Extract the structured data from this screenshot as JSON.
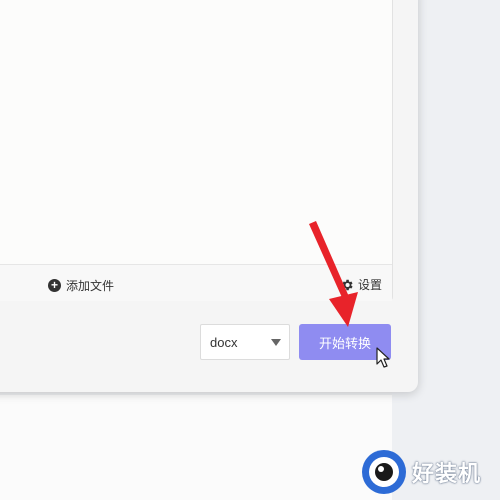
{
  "file_panel": {
    "add_file_label": "添加文件",
    "settings_label": "设置"
  },
  "output": {
    "format_value": "docx",
    "start_button_label": "开始转换"
  },
  "watermark": {
    "text": "好装机"
  },
  "colors": {
    "accent_button": "#8f8cf1",
    "annotation_arrow": "#e8232a"
  },
  "icons": [
    "plus-circle-icon",
    "gear-icon",
    "chevron-down-icon",
    "cursor-icon",
    "watermark-logo-icon"
  ]
}
